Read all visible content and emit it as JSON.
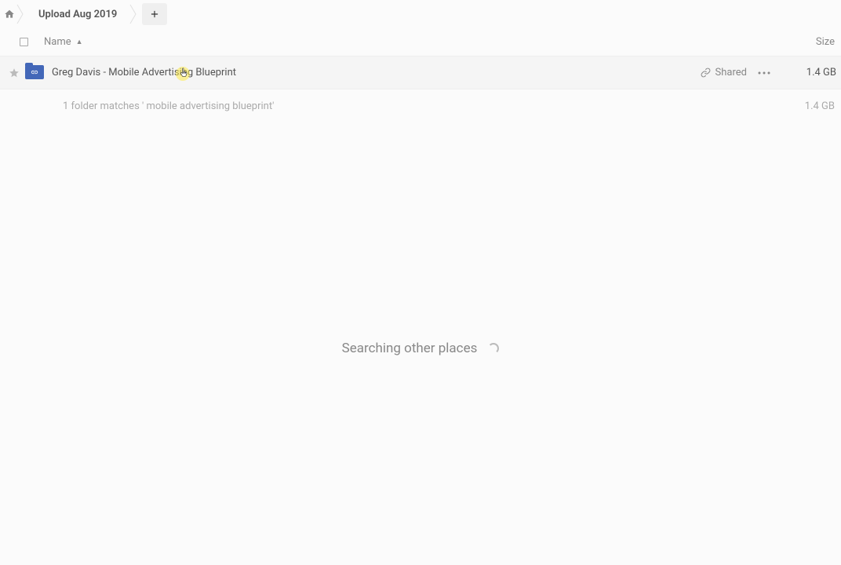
{
  "breadcrumb": {
    "current": "Upload Aug 2019"
  },
  "columns": {
    "name": "Name",
    "size": "Size"
  },
  "row": {
    "name": "Greg Davis - Mobile Advertising Blueprint",
    "shared_label": "Shared",
    "size": "1.4 GB"
  },
  "summary": {
    "text": "1 folder matches ' mobile advertising blueprint'",
    "total_size": "1.4 GB"
  },
  "status": {
    "searching": "Searching other places"
  }
}
